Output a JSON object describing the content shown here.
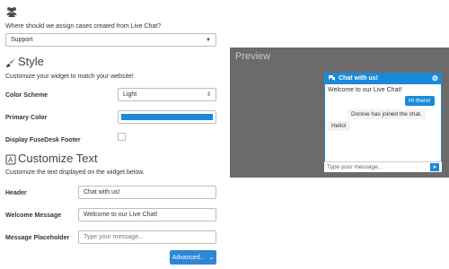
{
  "assign": {
    "question": "Where should we assign cases created from Live Chat?",
    "value": "Support"
  },
  "style_section": {
    "title": "Style",
    "subtitle": "Customize your widget to match your website!",
    "color_scheme_label": "Color Scheme",
    "color_scheme_value": "Light",
    "primary_color_label": "Primary Color",
    "primary_color": "#1a8ad8",
    "footer_label": "Display FuseDesk Footer",
    "footer_checked": false
  },
  "customize_section": {
    "title": "Customize Text",
    "subtitle": "Customize the text displayed on the widget below.",
    "header_label": "Header",
    "header_value": "Chat with us!",
    "welcome_label": "Welcome Message",
    "welcome_value": "Welcome to our Live Chat!",
    "placeholder_label": "Message Placeholder",
    "placeholder_value": "Type your message...",
    "advanced_button": "Advanced..."
  },
  "preview": {
    "title": "Preview",
    "widget_header": "Chat with us!",
    "welcome": "Welcome to our Live Chat!",
    "msg_hi": "Hi there!",
    "msg_joined": "Donnie has joined the chat.",
    "msg_hello": "Hello!",
    "input_placeholder": "Type your message..."
  },
  "icons": [
    "users-icon",
    "brush-icon",
    "text-format-icon",
    "chat-icon",
    "gear-icon",
    "send-icon",
    "chevron-down-icon"
  ],
  "colors": {
    "accent": "#1a8ad8",
    "button": "#2e86d6",
    "preview_bg": "#6b6b6b"
  }
}
